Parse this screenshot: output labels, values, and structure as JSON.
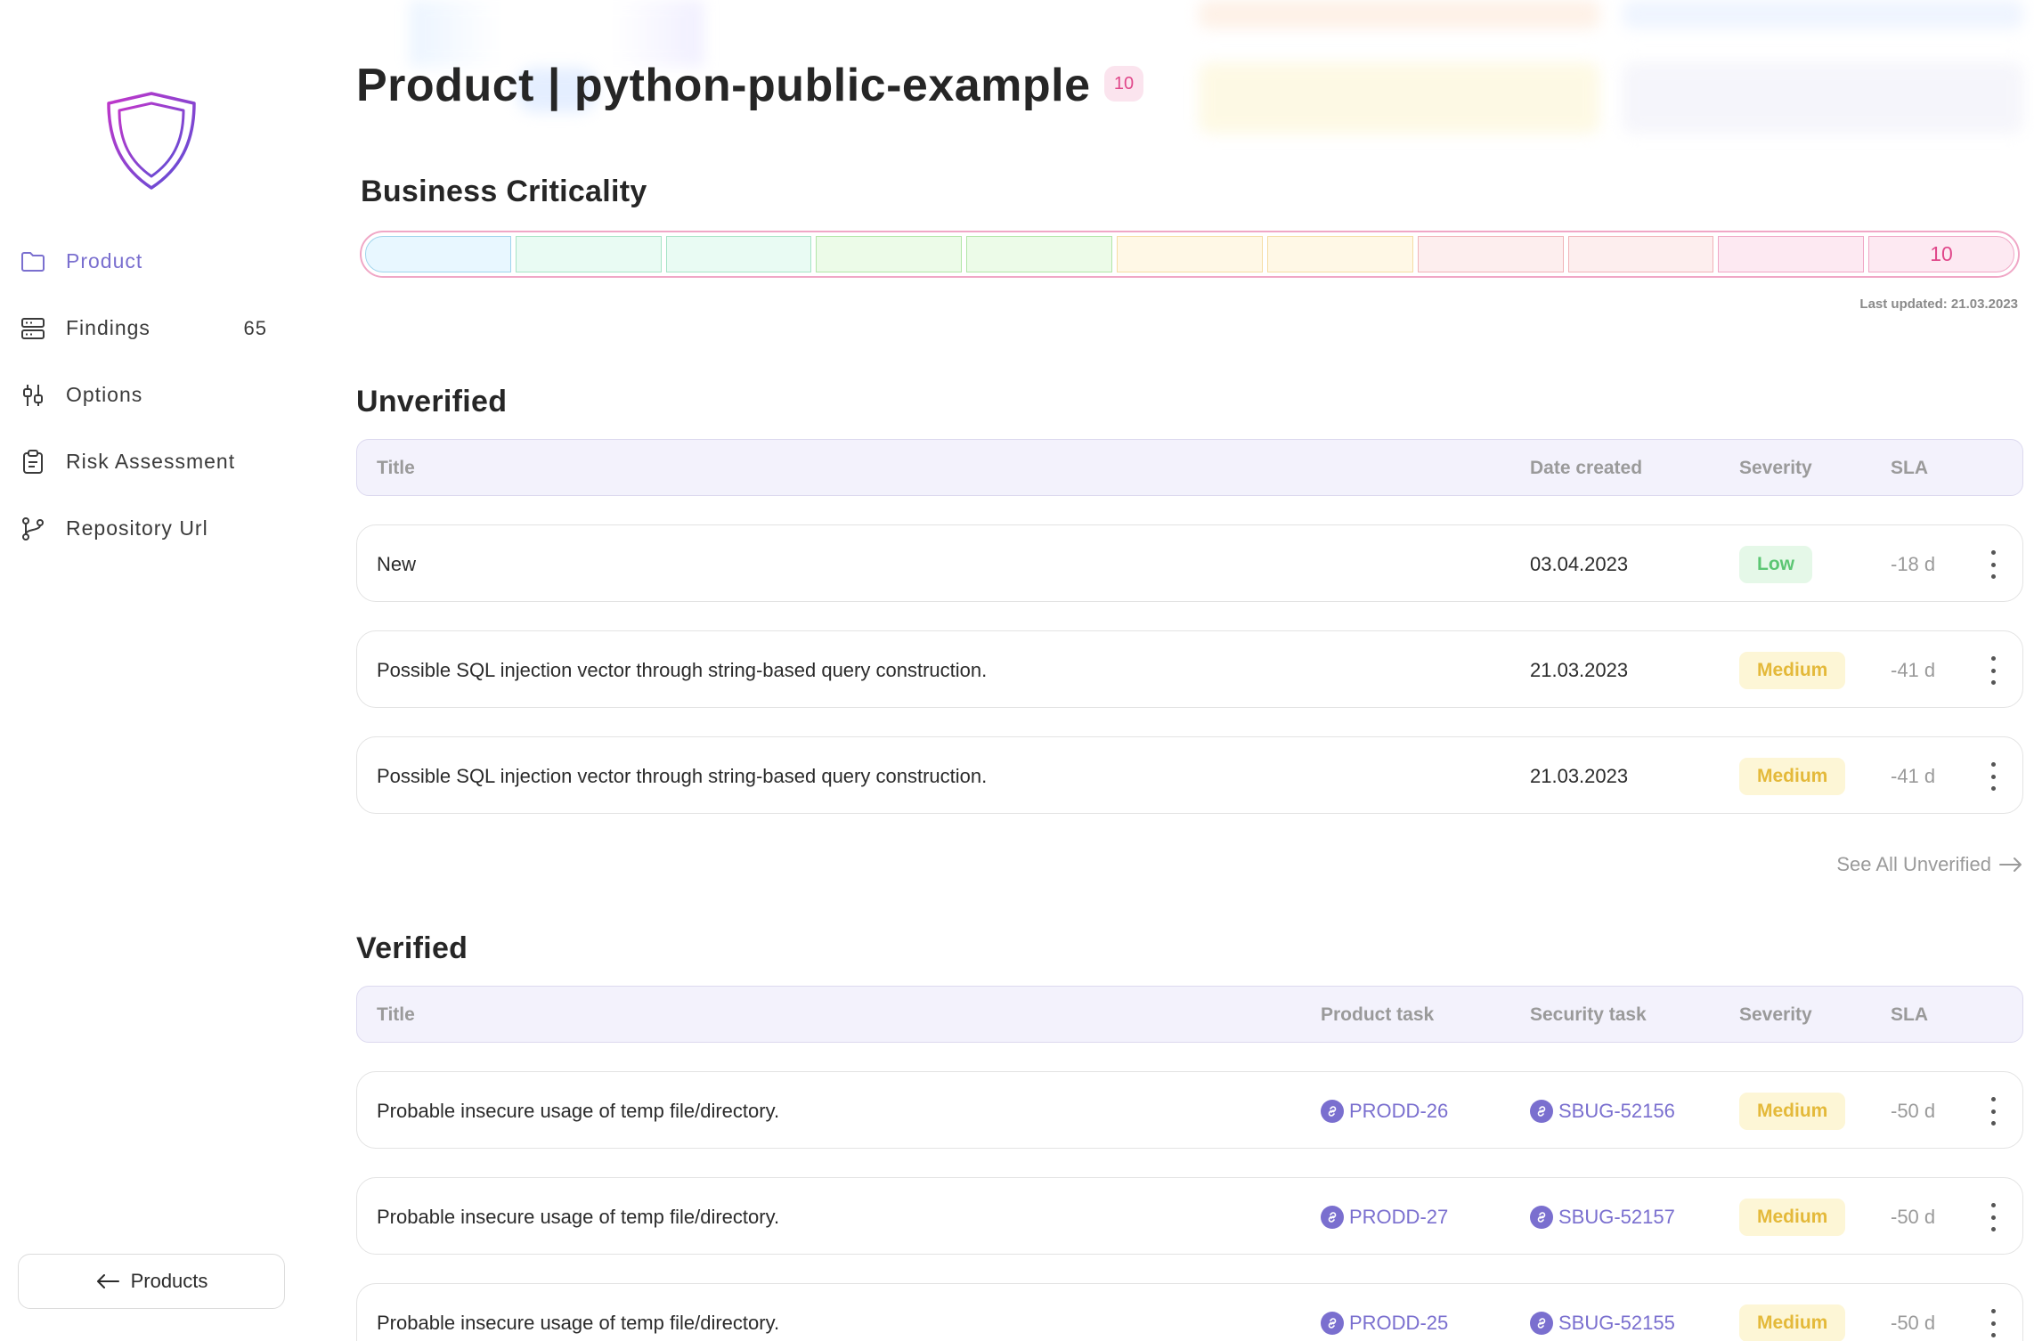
{
  "sidebar": {
    "items": [
      {
        "label": "Product",
        "icon": "folder-icon",
        "active": true
      },
      {
        "label": "Findings",
        "icon": "server-icon",
        "count": "65"
      },
      {
        "label": "Options",
        "icon": "sliders-icon"
      },
      {
        "label": "Risk Assessment",
        "icon": "clipboard-icon"
      },
      {
        "label": "Repository Url",
        "icon": "git-branch-icon"
      }
    ],
    "back_label": "Products"
  },
  "header": {
    "title": "Product | python-public-example",
    "badge": "10"
  },
  "criticality": {
    "heading": "Business Criticality",
    "level": 10,
    "segments": 11,
    "last_updated": "Last updated: 21.03.2023",
    "label": "10"
  },
  "unverified": {
    "heading": "Unverified",
    "columns": {
      "title": "Title",
      "date": "Date created",
      "severity": "Severity",
      "sla": "SLA"
    },
    "rows": [
      {
        "title": "New",
        "date": "03.04.2023",
        "severity": "Low",
        "sla": "-18 d"
      },
      {
        "title": "Possible SQL injection vector through string-based query construction.",
        "date": "21.03.2023",
        "severity": "Medium",
        "sla": "-41 d"
      },
      {
        "title": "Possible SQL injection vector through string-based query construction.",
        "date": "21.03.2023",
        "severity": "Medium",
        "sla": "-41 d"
      }
    ],
    "see_all": "See All Unverified"
  },
  "verified": {
    "heading": "Verified",
    "columns": {
      "title": "Title",
      "product_task": "Product task",
      "security_task": "Security task",
      "severity": "Severity",
      "sla": "SLA"
    },
    "rows": [
      {
        "title": "Probable insecure usage of temp file/directory.",
        "product_task": "PRODD-26",
        "security_task": "SBUG-52156",
        "severity": "Medium",
        "sla": "-50 d"
      },
      {
        "title": "Probable insecure usage of temp file/directory.",
        "product_task": "PRODD-27",
        "security_task": "SBUG-52157",
        "severity": "Medium",
        "sla": "-50 d"
      },
      {
        "title": "Probable insecure usage of temp file/directory.",
        "product_task": "PRODD-25",
        "security_task": "SBUG-52155",
        "severity": "Medium",
        "sla": "-50 d"
      }
    ]
  },
  "colors": {
    "accent": "#7a6fcf",
    "criticality_pink": "#e0478a",
    "low_green": "#5cc673",
    "medium_yellow": "#e4b93a"
  }
}
